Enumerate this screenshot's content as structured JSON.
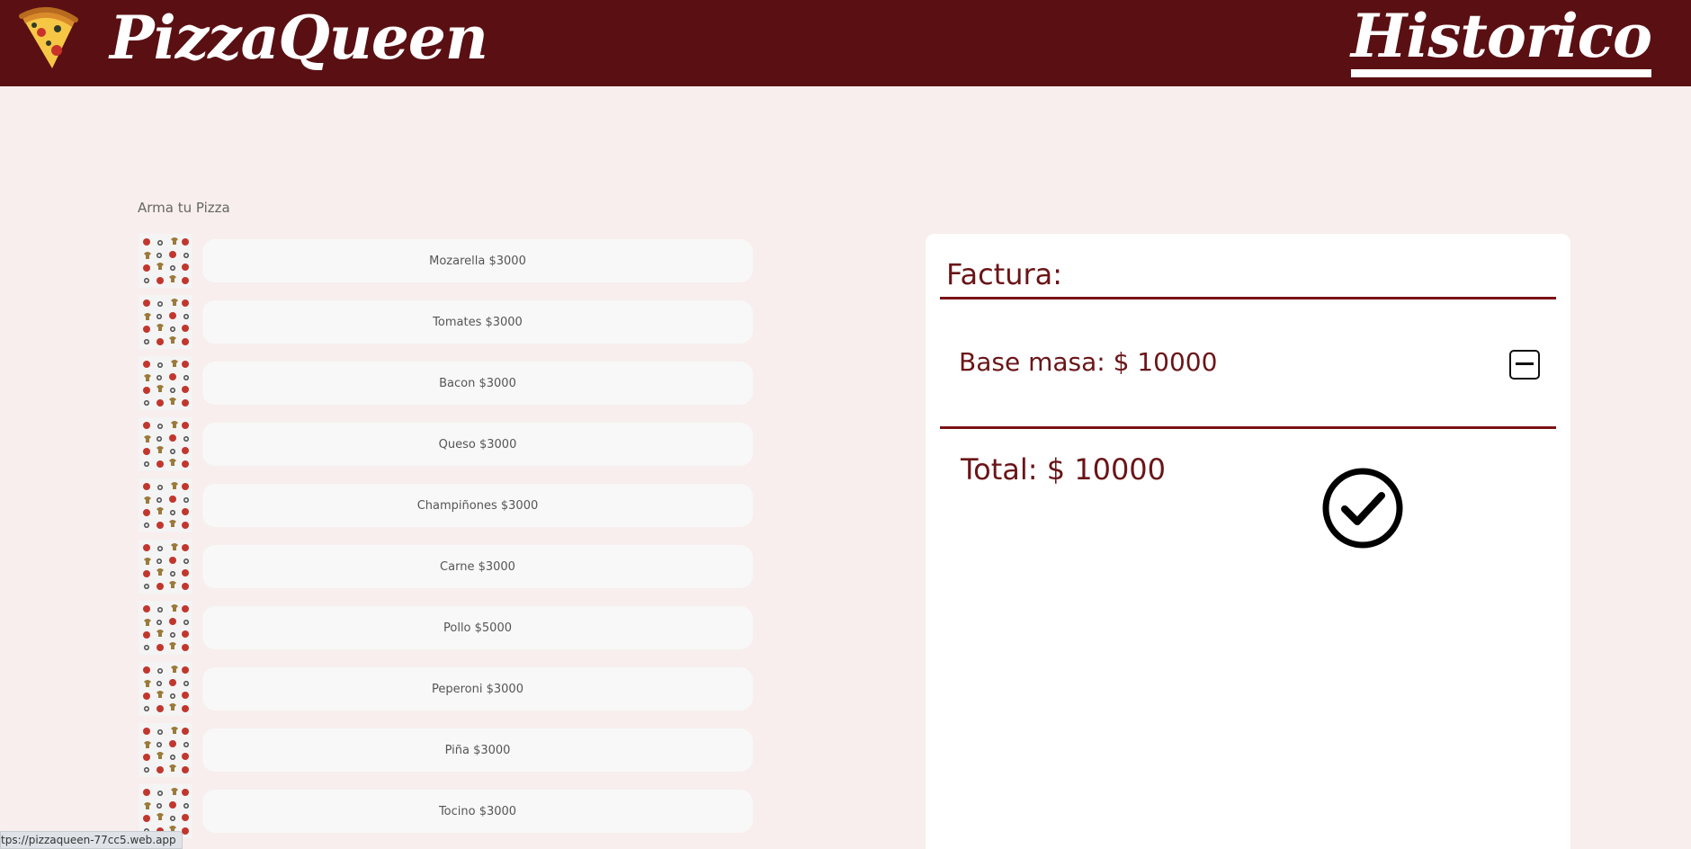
{
  "header": {
    "brand_icon": "pizza-slice-icon",
    "brand_name": "PizzaQueen",
    "history_link": "Historico",
    "background_color": "#5a1013"
  },
  "builder": {
    "title": "Arma tu Pizza",
    "thumbnail_icon": "toppings-icon",
    "ingredients": [
      {
        "label": "Mozarella $3000"
      },
      {
        "label": "Tomates $3000"
      },
      {
        "label": "Bacon $3000"
      },
      {
        "label": "Queso $3000"
      },
      {
        "label": "Champiñones $3000"
      },
      {
        "label": "Carne $3000"
      },
      {
        "label": "Pollo $5000"
      },
      {
        "label": "Peperoni $3000"
      },
      {
        "label": "Piña $3000"
      },
      {
        "label": "Tocino $3000"
      }
    ]
  },
  "invoice": {
    "title": "Factura:",
    "items": [
      {
        "label": "Base masa: $ 10000",
        "remove_icon": "minus-square-icon"
      }
    ],
    "total": "Total: $ 10000",
    "confirm_icon": "check-circle-icon",
    "accent_color": "#6a1518"
  },
  "status_bar": {
    "url": "tps://pizzaqueen-77cc5.web.app"
  }
}
